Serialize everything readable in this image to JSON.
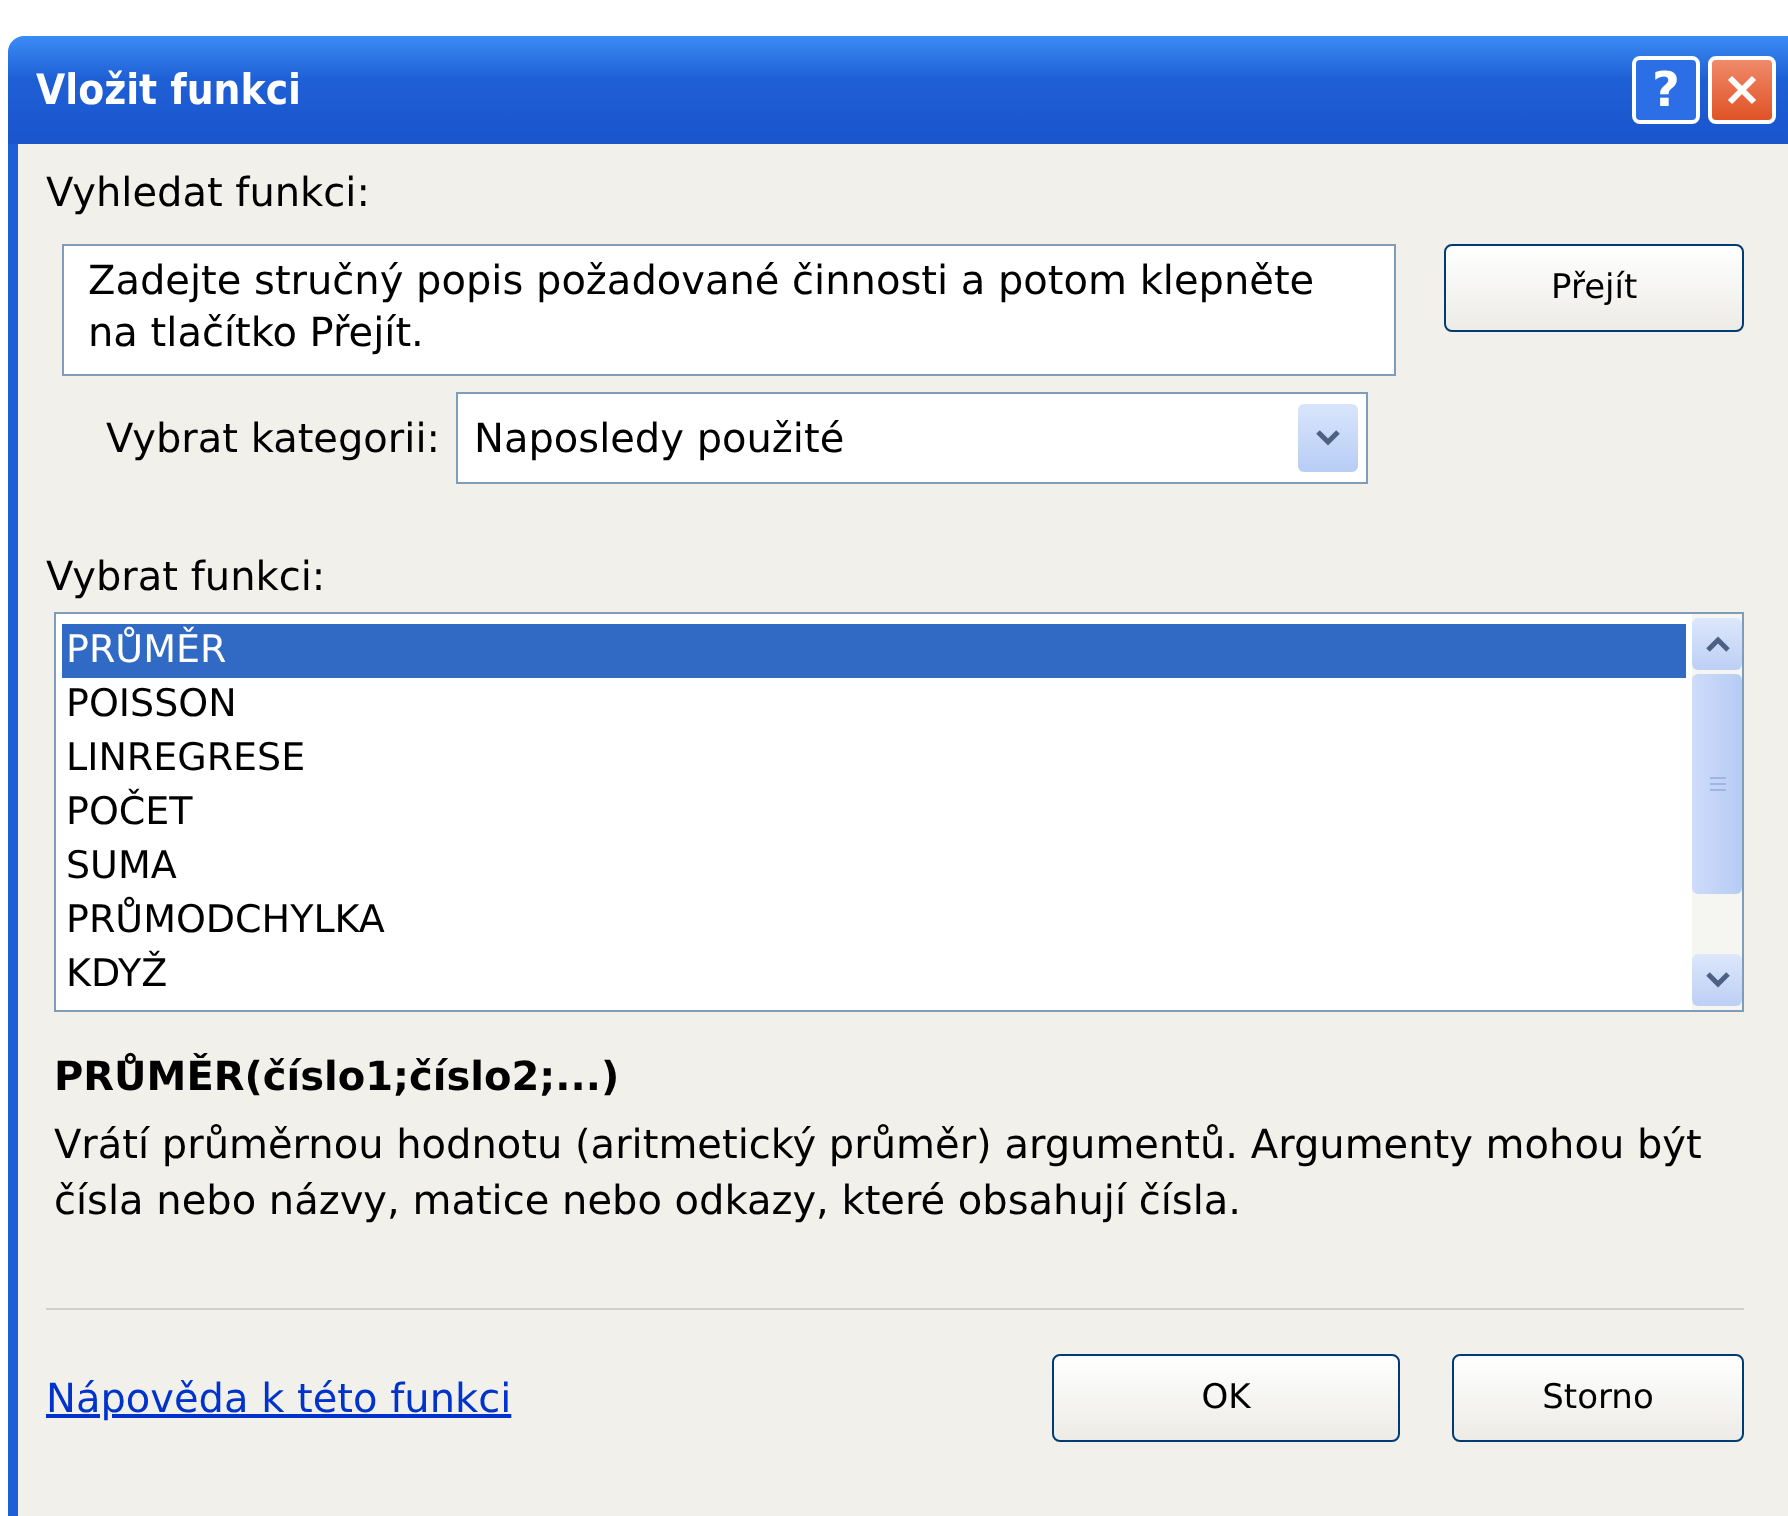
{
  "window": {
    "title": "Vložit funkci",
    "help_button": "?"
  },
  "search": {
    "label": "Vyhledat funkci:",
    "value": "Zadejte stručný popis požadované činnosti a potom klepněte na tlačítko Přejít.",
    "button": "Přejít"
  },
  "category": {
    "label": "Vybrat kategorii:",
    "value": "Naposledy použité"
  },
  "functions": {
    "label": "Vybrat funkci:",
    "items": [
      {
        "name": "PRŮMĚR",
        "selected": true
      },
      {
        "name": "POISSON",
        "selected": false
      },
      {
        "name": "LINREGRESE",
        "selected": false
      },
      {
        "name": "POČET",
        "selected": false
      },
      {
        "name": "SUMA",
        "selected": false
      },
      {
        "name": "PRŮMODCHYLKA",
        "selected": false
      },
      {
        "name": "KDYŽ",
        "selected": false
      }
    ]
  },
  "details": {
    "signature": "PRŮMĚR(číslo1;číslo2;...)",
    "description": "Vrátí průměrnou hodnotu (aritmetický průměr) argumentů. Argumenty mohou být čísla nebo názvy, matice nebo odkazy, které obsahují čísla."
  },
  "footer": {
    "help_link": "Nápověda k této funkci",
    "buttons": [
      "OK",
      "Storno"
    ]
  }
}
